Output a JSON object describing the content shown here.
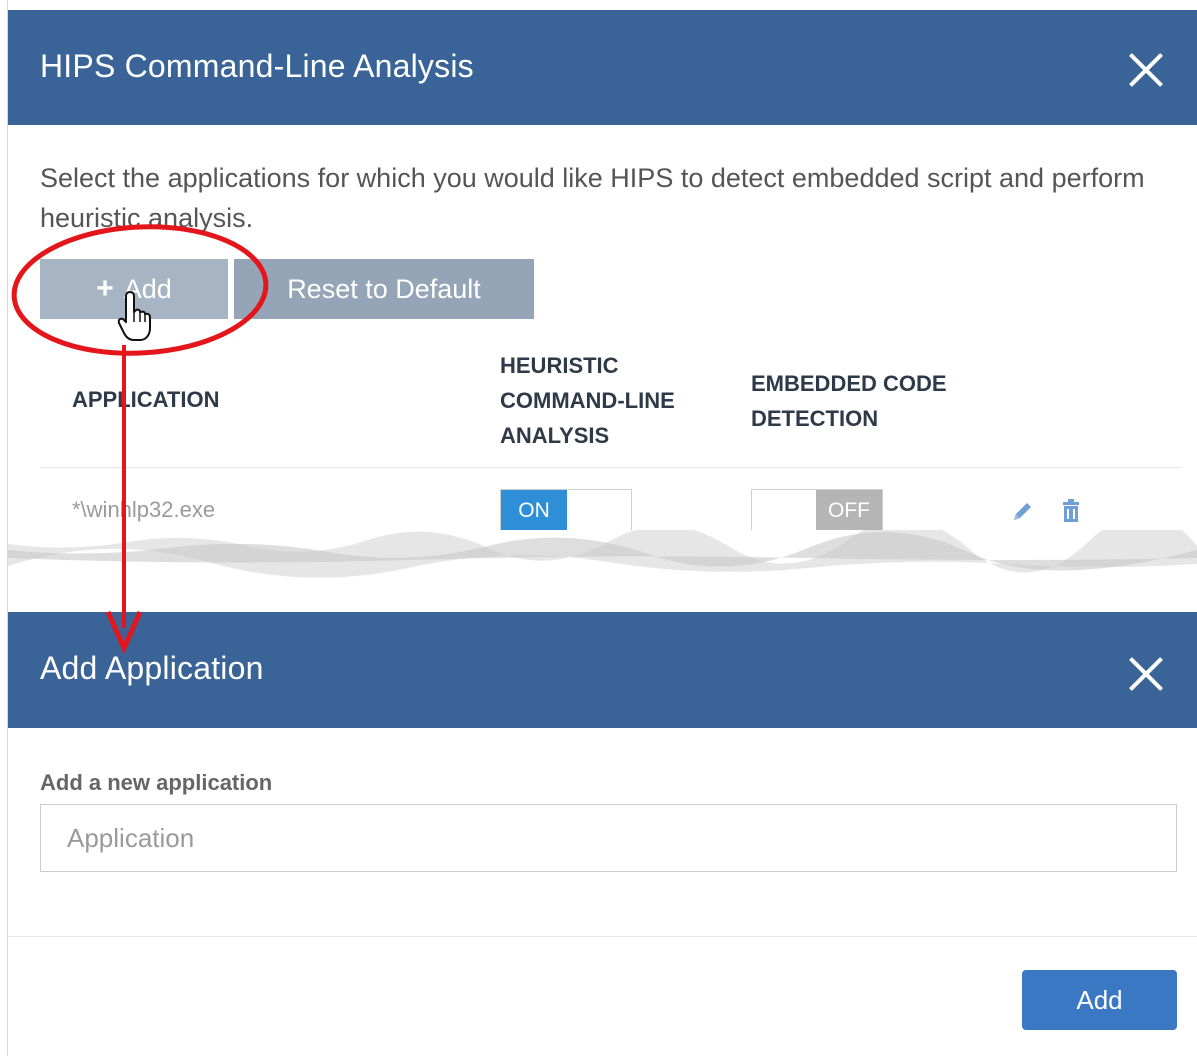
{
  "dialog1": {
    "title": "HIPS Command-Line Analysis",
    "description": "Select the applications for which you would like HIPS to detect embedded script and perform heuristic analysis.",
    "buttons": {
      "add_label": "Add",
      "reset_label": "Reset to Default"
    },
    "table": {
      "headers": {
        "application": "APPLICATION",
        "heuristic": "HEURISTIC COMMAND-LINE ANALYSIS",
        "embedded": "EMBEDDED CODE DETECTION"
      },
      "rows": [
        {
          "application": "*\\winhlp32.exe",
          "heuristic": "ON",
          "embedded": "OFF"
        }
      ]
    }
  },
  "dialog2": {
    "title": "Add Application",
    "field_label": "Add a new application",
    "input_placeholder": "Application",
    "input_value": "",
    "add_label": "Add"
  },
  "colors": {
    "header_bg": "#3a6497",
    "toggle_on": "#2e8fd8",
    "toggle_off": "#b5b5b5",
    "primary_button": "#3b78c4",
    "annotation": "#e5161b"
  },
  "icons": [
    "close-icon",
    "plus-icon",
    "edit-icon",
    "delete-icon",
    "hand-cursor-icon"
  ]
}
